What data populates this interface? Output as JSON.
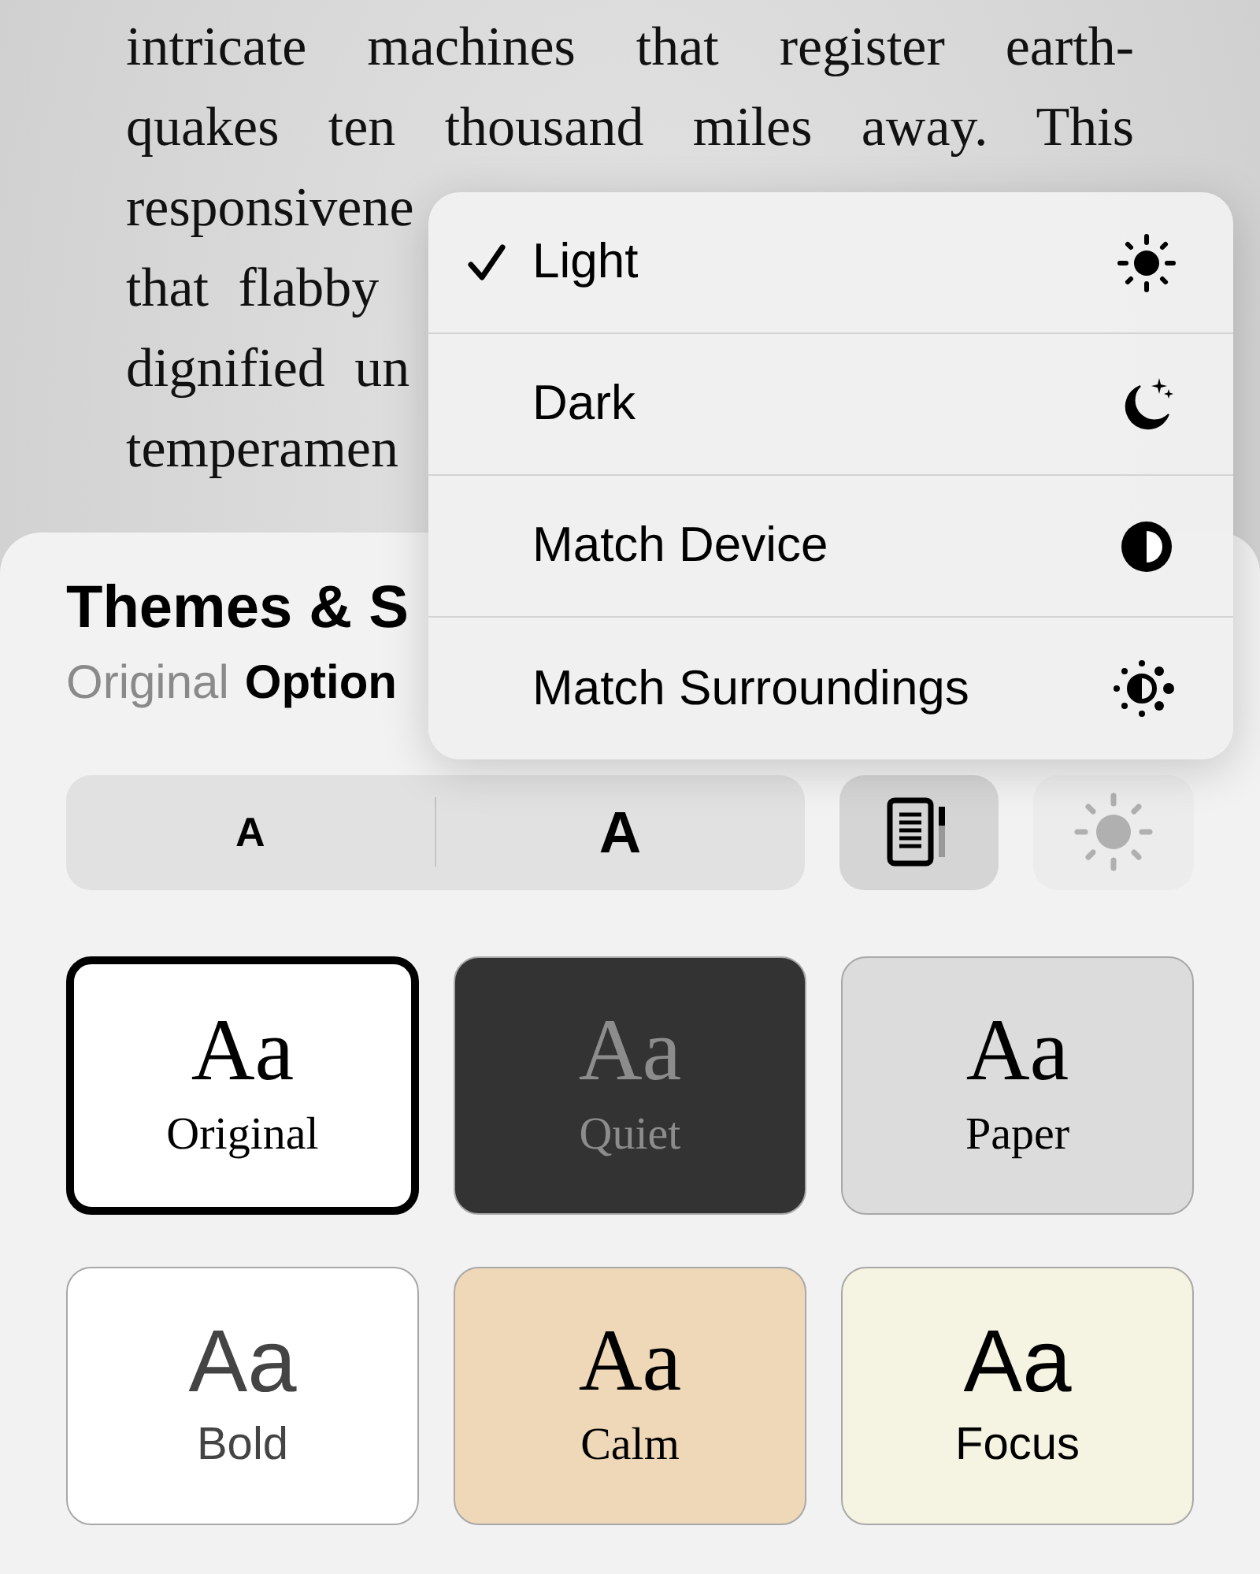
{
  "book_text": {
    "lines": [
      "intricate machines that register earth-",
      "quakes ten thousand miles away. This",
      "responsivene",
      "that flabby",
      "dignified un",
      "temperamen"
    ]
  },
  "sheet": {
    "title": "Themes & S",
    "breadcrumb": "Original",
    "current": "Option"
  },
  "controls": {
    "smaller_text": "A",
    "larger_text": "A",
    "layout_selected": true,
    "brightness_disabled": true
  },
  "themes": [
    {
      "sample": "Aa",
      "label": "Original",
      "kind": "serif",
      "color": "#ffffff",
      "selected": true
    },
    {
      "sample": "Aa",
      "label": "Quiet",
      "kind": "serif",
      "color": "#333333",
      "selected": false
    },
    {
      "sample": "Aa",
      "label": "Paper",
      "kind": "serif",
      "color": "#dcdcdc",
      "selected": false
    },
    {
      "sample": "Aa",
      "label": "Bold",
      "kind": "sans",
      "color": "#ffffff",
      "selected": false
    },
    {
      "sample": "Aa",
      "label": "Calm",
      "kind": "serif",
      "color": "#efd8b8",
      "selected": false
    },
    {
      "sample": "Aa",
      "label": "Focus",
      "kind": "sans",
      "color": "#f5f3e1",
      "selected": false
    }
  ],
  "menu": {
    "items": [
      {
        "label": "Light",
        "kind": "light",
        "checked": true
      },
      {
        "label": "Dark",
        "kind": "dark",
        "checked": false
      },
      {
        "label": "Match Device",
        "kind": "device",
        "checked": false
      },
      {
        "label": "Match Surroundings",
        "kind": "surroundings",
        "checked": false
      }
    ]
  }
}
